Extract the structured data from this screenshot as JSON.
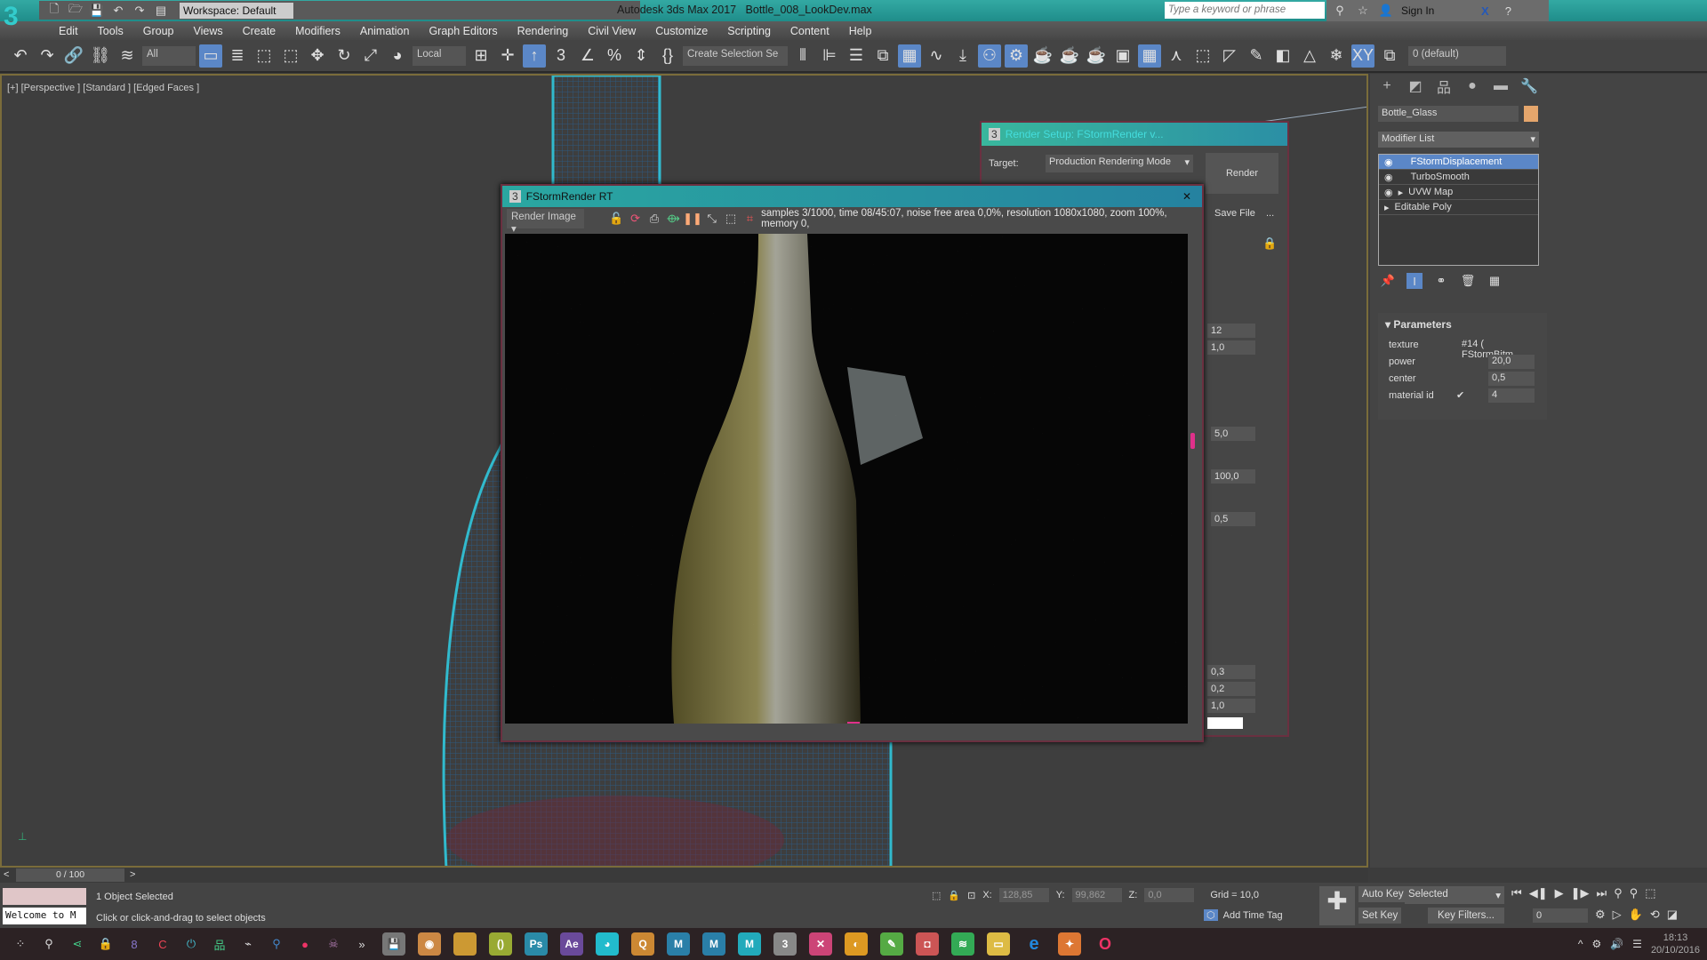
{
  "app": {
    "title": "Autodesk 3ds Max 2017",
    "file": "Bottle_008_LookDev.max",
    "workspace": "Workspace: Default",
    "search_placeholder": "Type a keyword or phrase",
    "sign_in": "Sign In",
    "logo": "3"
  },
  "menu": [
    "Edit",
    "Tools",
    "Group",
    "Views",
    "Create",
    "Modifiers",
    "Animation",
    "Graph Editors",
    "Rendering",
    "Civil View",
    "Customize",
    "Scripting",
    "Content",
    "Help"
  ],
  "toolbar": {
    "filter": "All",
    "coord": "Local",
    "selection_set": "Create Selection Se",
    "layer": "0 (default)"
  },
  "viewport": {
    "label": "[+] [Perspective ] [Standard ] [Edged Faces ]",
    "wire_color": "#2fd0e6"
  },
  "command_panel": {
    "object_name": "Bottle_Glass",
    "object_color": "#e5a66c",
    "modifier_list": "Modifier List",
    "stack": [
      {
        "label": "FStormDisplacement",
        "selected": true,
        "eye": true
      },
      {
        "label": "TurboSmooth",
        "eye": true
      },
      {
        "label": "UVW Map",
        "eye": true,
        "expand": true
      },
      {
        "label": "Editable Poly",
        "expand": true
      }
    ],
    "rollout": "Parameters",
    "params": [
      {
        "label": "texture",
        "value": "#14 ( FStormBitm"
      },
      {
        "label": "power",
        "value": "20,0"
      },
      {
        "label": "center",
        "value": "0,5"
      },
      {
        "label": "material id",
        "value": "4",
        "checked": true
      }
    ]
  },
  "render_setup": {
    "title": "Render Setup: FStormRender v...",
    "target_label": "Target:",
    "target_value": "Production Rendering Mode",
    "render_button": "Render",
    "save_file": "Save File",
    "more": "...",
    "values": [
      "12",
      "1,0",
      "5,0",
      "100,0",
      "0,5",
      "0,3",
      "0,2",
      "1,0"
    ]
  },
  "render_window": {
    "title": "FStormRender RT",
    "channel": "Render Image",
    "status": "samples 3/1000,  time 08/45:07,  noise free area 0,0%,  resolution 1080x1080,  zoom 100%,  memory 0,"
  },
  "timeline": {
    "frame": "0 / 100"
  },
  "status": {
    "selected": "1 Object Selected",
    "prompt": "Click or click-and-drag to select objects",
    "listener": "Welcome to M",
    "x_label": "X:",
    "x": "128,85",
    "y_label": "Y:",
    "y": "99,862",
    "z_label": "Z:",
    "z": "0,0",
    "grid": "Grid = 10,0",
    "add_time_tag": "Add Time Tag",
    "auto_key": "Auto Key",
    "set_key": "Set Key",
    "key_mode": "Selected",
    "key_filters": "Key Filters...",
    "frame": "0"
  },
  "taskbar": {
    "apps": [
      "Ps",
      "Ae",
      "M",
      "M",
      "M",
      "3"
    ],
    "time": "18:13",
    "date": "20/10/2016"
  }
}
